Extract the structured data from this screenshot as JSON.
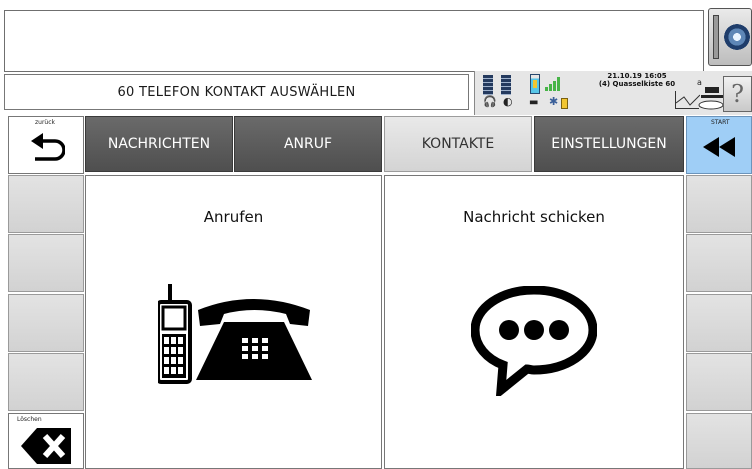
{
  "text_area": {
    "value": ""
  },
  "status": {
    "line": "60 TELEFON KONTAKT AUSWÄHLEN",
    "datetime": "21.10.19 16:05",
    "profile": "(4) Quasselkiste 60"
  },
  "nav": {
    "tabs": [
      {
        "label": "NACHRICHTEN",
        "active": false
      },
      {
        "label": "ANRUF",
        "active": false
      },
      {
        "label": "KONTAKTE",
        "active": true
      },
      {
        "label": "EINSTELLUNGEN",
        "active": false
      }
    ],
    "back_label": "zurück",
    "start_label": "START",
    "delete_label": "Löschen"
  },
  "cards": [
    {
      "title": "Anrufen",
      "icon": "phone-icon"
    },
    {
      "title": "Nachricht schicken",
      "icon": "speech-bubble-icon"
    }
  ],
  "colors": {
    "nav_dark": "#5a5a5a",
    "nav_active": "#dddddd",
    "start_blue": "#9fcef6",
    "side_gray": "#d9d9d9"
  },
  "help_symbol": "?"
}
